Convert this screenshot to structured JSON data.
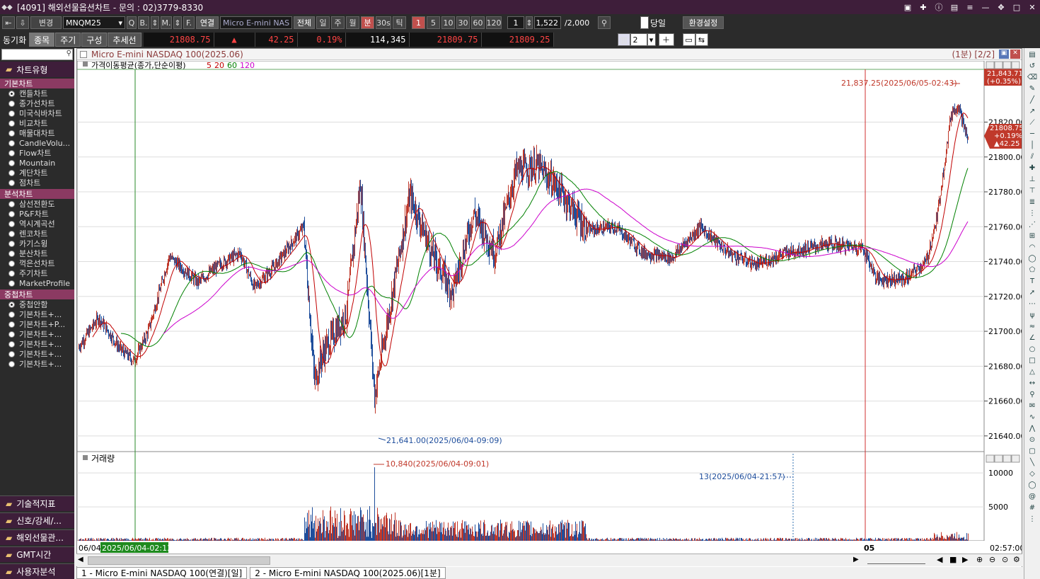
{
  "window": {
    "title": "[4091] 해외선물옵션차트 - 문의 : 02)3779-8330"
  },
  "toolbar": {
    "change_label": "변경",
    "symbol": "MNQM25",
    "btn_q": "Q",
    "btn_b": "B.",
    "btn_m": "M.",
    "btn_f": "F.",
    "link_label": "연결",
    "name_field": "Micro E-mini NAS",
    "all_label": "전체",
    "periods": [
      "일",
      "주",
      "월",
      "분",
      "30s",
      "틱"
    ],
    "selected_period": "분",
    "intervals": [
      "1",
      "5",
      "10",
      "30",
      "60",
      "120"
    ],
    "interval_value": "1",
    "count_value": "1,522",
    "max_count": "/2,000",
    "today_label": "당일",
    "settings_label": "환경설정"
  },
  "toolbar2": {
    "sync_label": "동기화",
    "tabs": [
      "종목",
      "주기",
      "구성",
      "추세선"
    ],
    "price": "21808.75",
    "up_arrow": "▲",
    "change": "42.25",
    "pct": "0.19%",
    "volume": "114,345",
    "bid": "21809.75",
    "ask": "21809.25",
    "layout_count": "2"
  },
  "sidebar": {
    "header": "차트유형",
    "sections": [
      {
        "title": "기본차트",
        "items": [
          "캔들차트",
          "종가선차트",
          "미국식바차트",
          "비교차트",
          "매물대차트",
          "CandleVolu...",
          "Flow차트",
          "Mountain",
          "계단차트",
          "점차트"
        ],
        "selected": 0
      },
      {
        "title": "분석차트",
        "items": [
          "삼선전환도",
          "P&F차트",
          "역시계곡선",
          "렌코차트",
          "카기스윙",
          "분산차트",
          "꺽은선차트",
          "주기차트",
          "MarketProfile"
        ],
        "selected": -1
      },
      {
        "title": "중첩차트",
        "items": [
          "중첩안함",
          "기본차트+...",
          "기본차트+P...",
          "기본차트+...",
          "기본차트+...",
          "기본차트+...",
          "기본차트+..."
        ],
        "selected": 0
      }
    ],
    "bottom": [
      "기술적지표",
      "신호/강세/...",
      "해외선물관...",
      "GMT시간",
      "사용자분석"
    ]
  },
  "chart": {
    "title": "Micro E-mini NASDAQ 100(2025.06)",
    "period_label": "(1분) [2/2]",
    "ma_label": "가격이동평균(종가,단순이평)",
    "ma_periods": [
      "5",
      "20",
      "60",
      "120"
    ],
    "volume_label": "거래량",
    "high_annot": "21,837.25(2025/06/05-02:43)",
    "low_annot": "21,641.00(2025/06/04-09:09)",
    "vol_max_annot": "10,840(2025/06/04-09:01)",
    "vol_cursor_annot": "13(2025/06/04-21:57)",
    "price_ticks": [
      "21820.00",
      "21800.00",
      "21780.00",
      "21760.00",
      "21740.00",
      "21720.00",
      "21700.00",
      "21680.00",
      "21660.00",
      "21640.00"
    ],
    "vol_ticks": [
      "10000",
      "5000"
    ],
    "tag_high": "21,843.71",
    "tag_high_pct": "(+0.35%)",
    "tag_cur": "21808.75",
    "tag_cur_pct": "+0.19%",
    "tag_cur_chg": "▲42.25",
    "x_start": "06/04",
    "x_cursor": "2025/06/04-02:13",
    "x_day": "05",
    "x_end": "02:57:00"
  },
  "bottom_tabs": [
    "1 - Micro E-mini NASDAQ 100(연결)[일]",
    "2 - Micro E-mini NASDAQ 100(2025.06)[1분]"
  ],
  "colors": {
    "up": "#c0392b",
    "down": "#1f4e9c",
    "ma5": "#c00000",
    "ma20": "#c00000",
    "ma60": "#008000",
    "ma120": "#cc00cc",
    "accent": "#3e1e3a"
  }
}
